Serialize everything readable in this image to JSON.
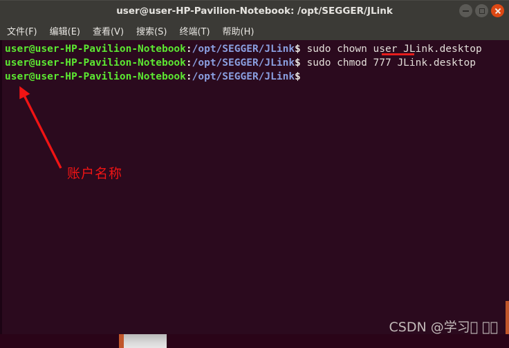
{
  "window": {
    "title": "user@user-HP-Pavilion-Notebook: /opt/SEGGER/JLink",
    "controls": {
      "minimize": "minimize",
      "maximize": "maximize",
      "close": "close"
    }
  },
  "menubar": {
    "items": [
      {
        "label": "文件(F)"
      },
      {
        "label": "编辑(E)"
      },
      {
        "label": "查看(V)"
      },
      {
        "label": "搜索(S)"
      },
      {
        "label": "终端(T)"
      },
      {
        "label": "帮助(H)"
      }
    ]
  },
  "terminal": {
    "prompt_user": "user@user-HP-Pavilion-Notebook",
    "prompt_colon": ":",
    "prompt_path": "/opt/SEGGER/JLink",
    "prompt_sigil": "$",
    "lines": [
      {
        "command": " sudo chown user JLink.desktop"
      },
      {
        "command": " sudo chmod 777 JLink.desktop"
      },
      {
        "command": ""
      }
    ],
    "colors": {
      "background": "#2b0a1e",
      "user": "#5ce832",
      "path": "#8a9fe0",
      "text": "#e3ded9"
    }
  },
  "annotation": {
    "label": "账户名称",
    "color": "#f01414",
    "underline_target": "user"
  },
  "watermark": {
    "text": "CSDN @学习\u0000 \u0000\u0000"
  }
}
